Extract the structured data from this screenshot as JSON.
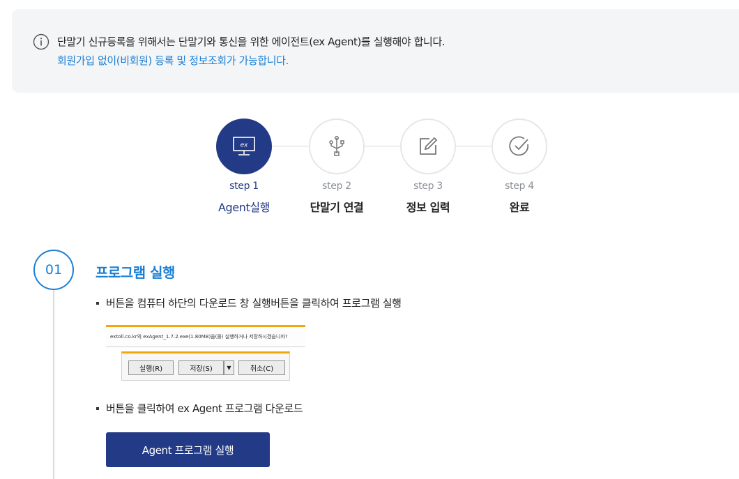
{
  "notice": {
    "icon": "info-circle-icon",
    "line1": "단말기 신규등록을 위해서는 단말기와 통신을 위한 에이전트(ex Agent)를 실행해야 합니다.",
    "line2": "회원가입 없이(비회원) 등록 및 정보조회가 가능합니다.",
    "highlight_color": "#1a7fd6"
  },
  "steps": [
    {
      "num": "step 1",
      "name": "Agent실행",
      "icon": "ex-monitor-icon",
      "active": true
    },
    {
      "num": "step 2",
      "name": "단말기 연결",
      "icon": "usb-icon",
      "active": false
    },
    {
      "num": "step 3",
      "name": "정보 입력",
      "icon": "edit-icon",
      "active": false
    },
    {
      "num": "step 4",
      "name": "완료",
      "icon": "check-circle-icon",
      "active": false
    }
  ],
  "section": {
    "number": "01",
    "title": "프로그램 실행",
    "bullet1": "버튼을 컴퓨터 하단의 다운로드 창 실행버튼을 클릭하여 프로그램 실행",
    "bullet2": "버튼을 클릭하여 ex Agent 프로그램 다운로드"
  },
  "download_prompt": {
    "message": "extoll.co.kr의 exAgent_1.7.2.exe(1.80MB)을(를) 실행하거나 저장하시겠습니까?",
    "run_label": "실행(R)",
    "save_label": "저장(S)",
    "cancel_label": "취소(C)"
  },
  "agent_button_label": "Agent 프로그램 실행",
  "colors": {
    "primary": "#233a86",
    "accent": "#1a7fd6",
    "download_bar": "#f1a70d"
  }
}
